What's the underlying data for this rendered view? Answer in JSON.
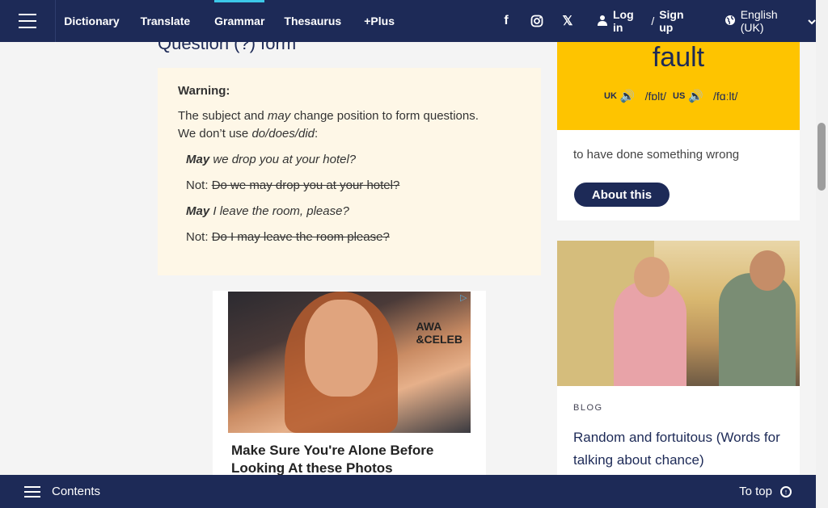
{
  "nav": {
    "dictionary": "Dictionary",
    "translate": "Translate",
    "grammar": "Grammar",
    "thesaurus": "Thesaurus",
    "plus": "+Plus",
    "login": "Log in",
    "separator": "/",
    "signup": "Sign up",
    "language": "English (UK)"
  },
  "section": {
    "heading": "Question (?) form"
  },
  "warning": {
    "title": "Warning:",
    "line1_a": "The subject and ",
    "line1_em": "may",
    "line1_b": " change position to form questions.",
    "line2_a": "We don’t use ",
    "line2_em": "do/does/did",
    "line2_b": ":",
    "ex1_b": "May",
    "ex1_rest": " we drop you at your hotel?",
    "ex2_not": "Not: ",
    "ex2_strike": "Do we may drop you at your hotel?",
    "ex3_b": "May",
    "ex3_rest": " I leave the room, please?",
    "ex4_not": "Not: ",
    "ex4_strike": "Do I may leave the room please?"
  },
  "ad": {
    "image_text": "AWA\n&CELEB",
    "title": "Make Sure You're Alone Before Looking At these Photos"
  },
  "wordcard": {
    "word": "fault",
    "uk_label": "UK",
    "uk_ipa": "/fɒlt/",
    "us_label": "US",
    "us_ipa": "/fɑːlt/",
    "definition": "to have done something wrong",
    "about_button": "About this"
  },
  "blog": {
    "label": "BLOG",
    "title": "Random and fortuitous (Words for talking about chance)"
  },
  "bottom": {
    "contents": "Contents",
    "to_top": "To top"
  }
}
